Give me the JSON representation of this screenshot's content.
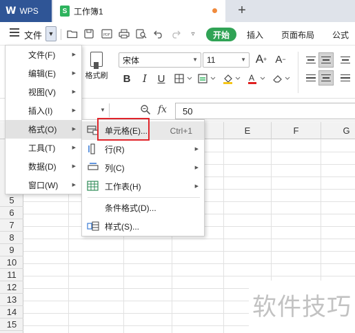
{
  "tabbar": {
    "app_name": "WPS",
    "document_tab": "工作簿1",
    "new_tab": "+"
  },
  "menubar": {
    "file_label": "文件",
    "ribbon_tabs": [
      "开始",
      "插入",
      "页面布局",
      "公式"
    ]
  },
  "ribbon": {
    "format_painter": "格式刷",
    "font_name": "宋体",
    "font_size": "11"
  },
  "formula_bar": {
    "fx_label": "fx",
    "value": "50"
  },
  "grid": {
    "columns": [
      "E",
      "F",
      "G"
    ],
    "rows": [
      "5",
      "6",
      "7",
      "8",
      "9",
      "10",
      "11",
      "12",
      "13",
      "14",
      "15"
    ]
  },
  "file_menu": {
    "items": [
      {
        "label": "文件(F)"
      },
      {
        "label": "编辑(E)"
      },
      {
        "label": "视图(V)"
      },
      {
        "label": "插入(I)"
      },
      {
        "label": "格式(O)"
      },
      {
        "label": "工具(T)"
      },
      {
        "label": "数据(D)"
      },
      {
        "label": "窗口(W)"
      }
    ]
  },
  "format_submenu": {
    "items": [
      {
        "label": "单元格(E)...",
        "shortcut": "Ctrl+1",
        "icon": "cell-format-icon"
      },
      {
        "label": "行(R)",
        "icon": "row-icon"
      },
      {
        "label": "列(C)",
        "icon": "column-icon"
      },
      {
        "label": "工作表(H)",
        "icon": "worksheet-icon"
      },
      {
        "label": "条件格式(D)..."
      },
      {
        "label": "样式(S)...",
        "icon": "style-icon"
      }
    ]
  },
  "watermark": "软件技巧",
  "colors": {
    "wps_blue": "#2f5596",
    "home_green": "#30a355",
    "highlight_red": "#e0242a"
  }
}
